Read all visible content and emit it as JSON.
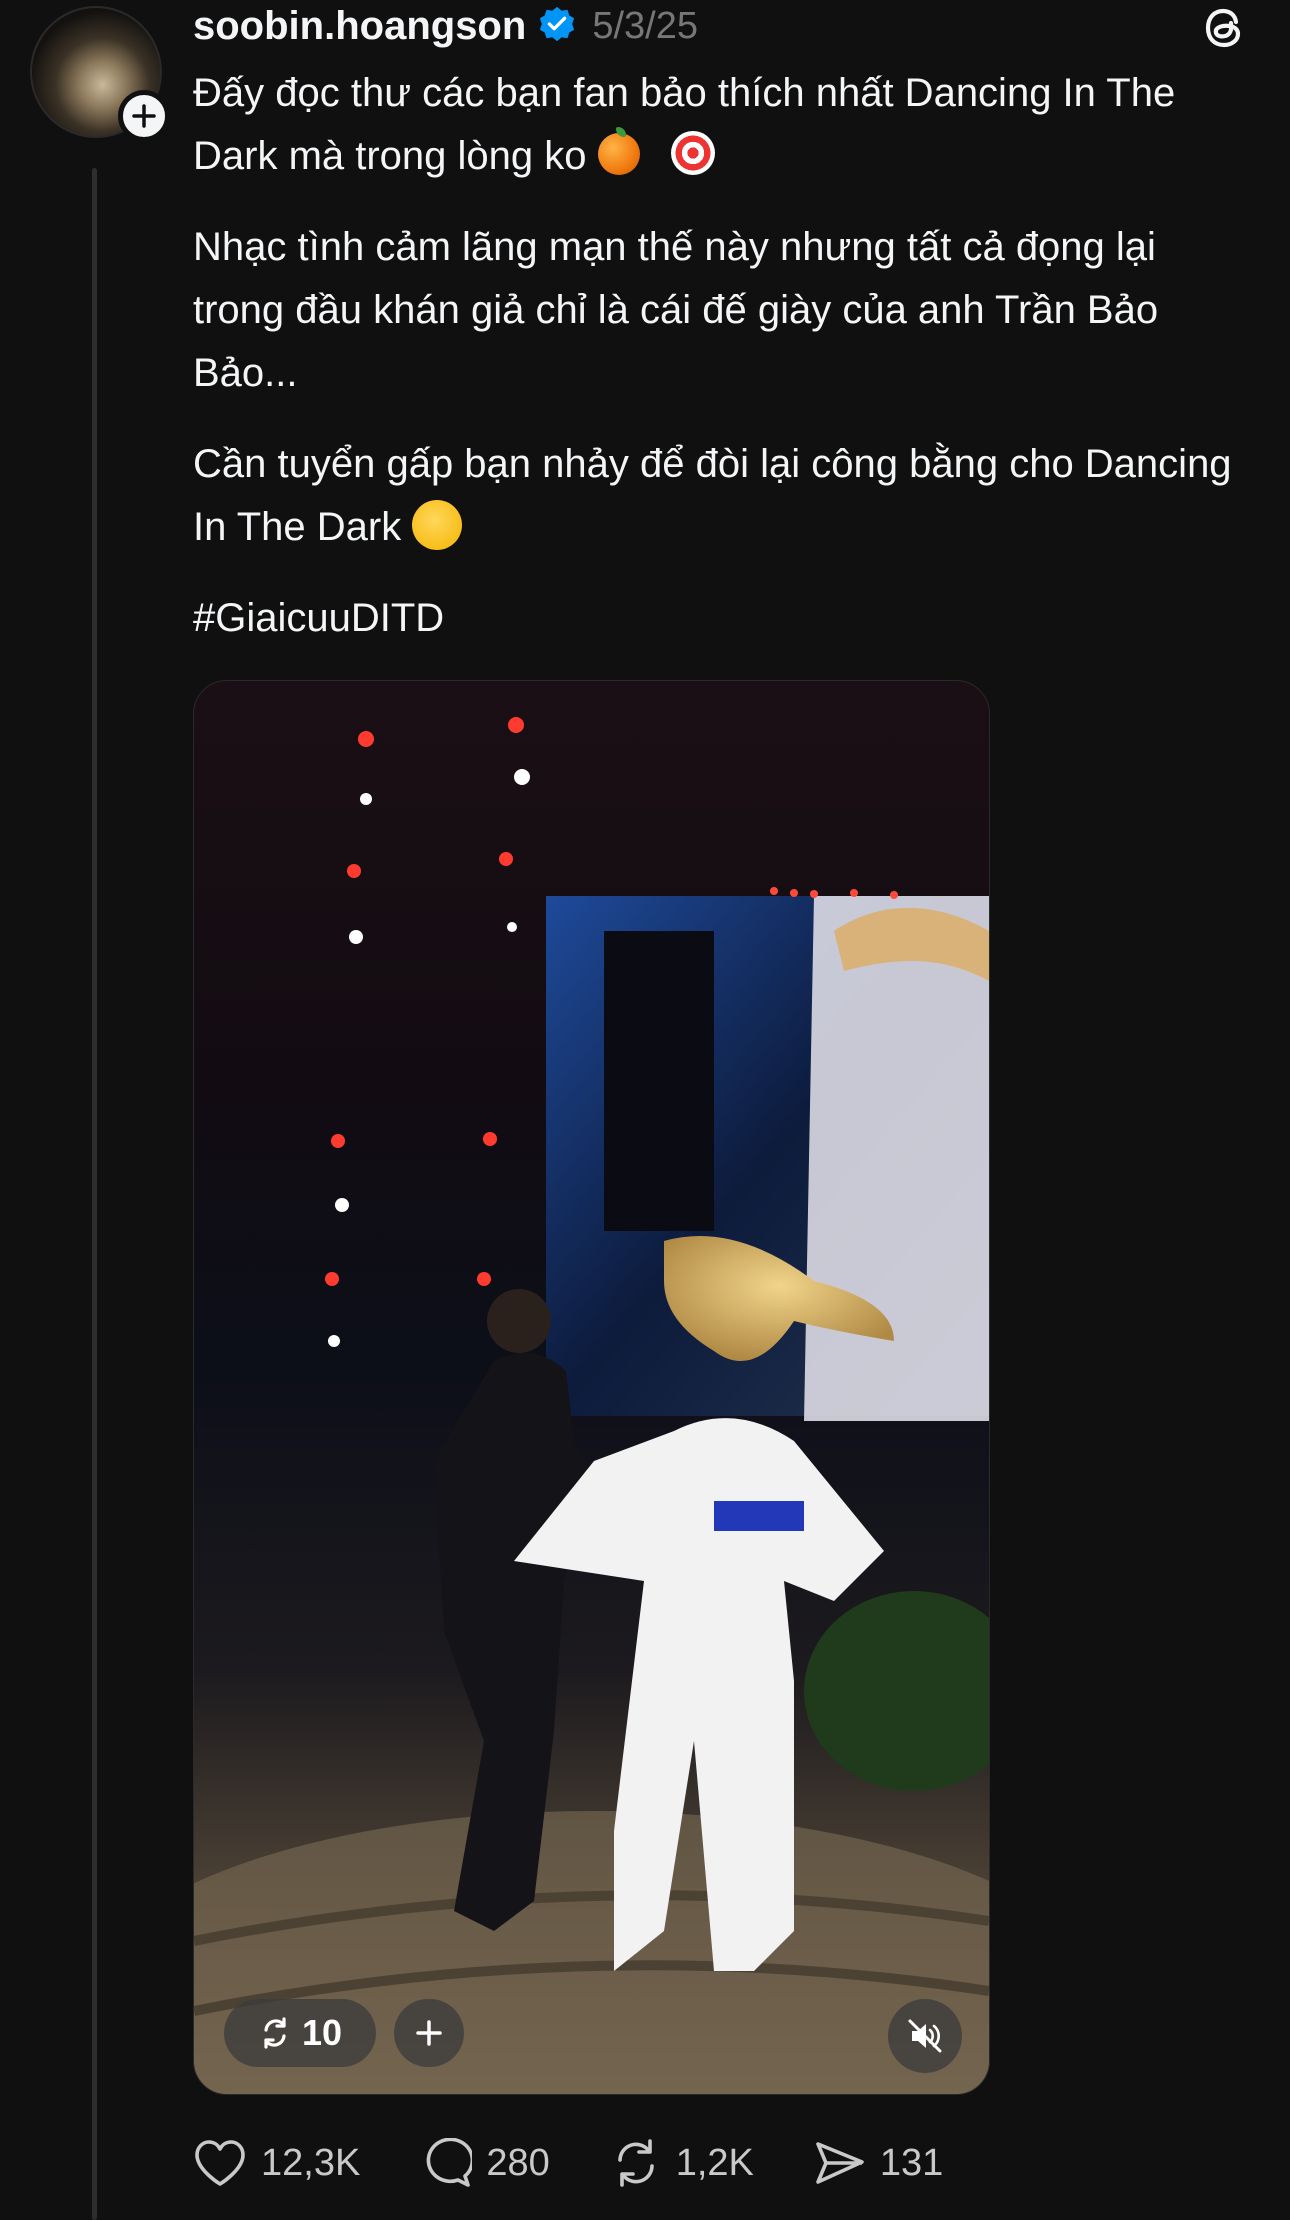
{
  "post": {
    "username": "soobin.hoangson",
    "date": "5/3/25",
    "paragraphs": {
      "p1_text": "Đấy đọc thư các bạn fan bảo thích nhất Dancing In The Dark mà trong lòng ko",
      "p2": "Nhạc tình cảm lãng mạn thế này nhưng tất cả đọng lại trong đầu khán giả chỉ là cái đế giày của anh Trần Bảo Bảo...",
      "p3_text": "Cần tuyển gấp bạn nhảy để đòi lại công bằng cho Dancing In The Dark",
      "hashtag": "#GiaicuuDITD"
    }
  },
  "video": {
    "repost_count": "10",
    "mute_icon": "speaker-muted-icon"
  },
  "actions": {
    "likes": "12,3K",
    "comments": "280",
    "reposts": "1,2K",
    "shares": "131"
  },
  "colors": {
    "background": "#101010",
    "text": "#f3f5f7",
    "muted": "#777777",
    "verified": "#0095f6"
  }
}
